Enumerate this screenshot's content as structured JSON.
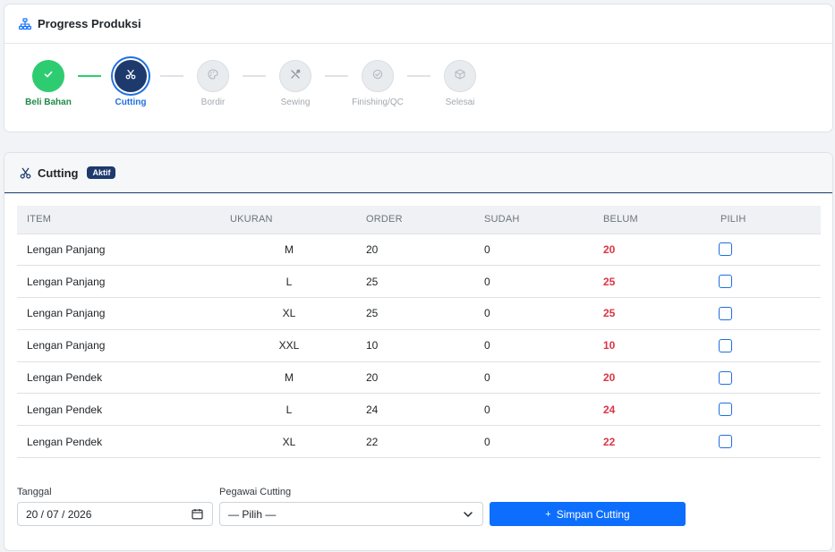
{
  "progress": {
    "title": "Progress Produksi",
    "steps": [
      {
        "label": "Beli Bahan",
        "state": "done",
        "icon": "check-icon"
      },
      {
        "label": "Cutting",
        "state": "active",
        "icon": "scissors-icon"
      },
      {
        "label": "Bordir",
        "state": "pending",
        "icon": "palette-icon"
      },
      {
        "label": "Sewing",
        "state": "pending",
        "icon": "tools-icon"
      },
      {
        "label": "Finishing/QC",
        "state": "pending",
        "icon": "check-circle-icon"
      },
      {
        "label": "Selesai",
        "state": "pending",
        "icon": "box-icon"
      }
    ]
  },
  "cutting": {
    "title": "Cutting",
    "badge": "Aktif",
    "columns": [
      "ITEM",
      "UKURAN",
      "ORDER",
      "SUDAH",
      "BELUM",
      "PILIH"
    ],
    "rows": [
      {
        "item": "Lengan Panjang",
        "ukuran": "M",
        "order": "20",
        "sudah": "0",
        "belum": "20",
        "pilih": false
      },
      {
        "item": "Lengan Panjang",
        "ukuran": "L",
        "order": "25",
        "sudah": "0",
        "belum": "25",
        "pilih": false
      },
      {
        "item": "Lengan Panjang",
        "ukuran": "XL",
        "order": "25",
        "sudah": "0",
        "belum": "25",
        "pilih": false
      },
      {
        "item": "Lengan Panjang",
        "ukuran": "XXL",
        "order": "10",
        "sudah": "0",
        "belum": "10",
        "pilih": false
      },
      {
        "item": "Lengan Pendek",
        "ukuran": "M",
        "order": "20",
        "sudah": "0",
        "belum": "20",
        "pilih": false
      },
      {
        "item": "Lengan Pendek",
        "ukuran": "L",
        "order": "24",
        "sudah": "0",
        "belum": "24",
        "pilih": false
      },
      {
        "item": "Lengan Pendek",
        "ukuran": "XL",
        "order": "22",
        "sudah": "0",
        "belum": "22",
        "pilih": false
      }
    ],
    "form": {
      "tanggal_label": "Tanggal",
      "tanggal_value": "20 / 07 / 2026",
      "pegawai_label": "Pegawai Cutting",
      "pegawai_value": "— Pilih —",
      "save_label": "Simpan Cutting"
    }
  },
  "colors": {
    "accent": "#0d6efd",
    "navy": "#1e3a6d",
    "success": "#2ecc71",
    "danger": "#dc3545"
  }
}
